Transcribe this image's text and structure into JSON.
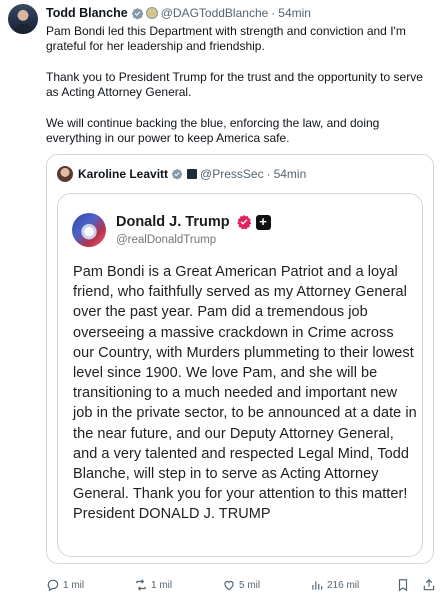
{
  "post": {
    "author_name": "Todd Blanche",
    "author_handle": "@DAGToddBlanche",
    "separator": "·",
    "time": "54min",
    "paragraphs": [
      "Pam Bondi led this Department with strength and conviction and I'm grateful for her leadership and friendship.",
      "Thank you to President Trump for the trust and the opportunity to serve as Acting Attorney General.",
      "We will continue backing the blue, enforcing the law, and doing everything in our power to keep America safe."
    ]
  },
  "quote": {
    "author_name": "Karoline Leavitt",
    "author_handle": "@PressSec",
    "separator": "·",
    "time": "54min",
    "embedded": {
      "author_name": "Donald J. Trump",
      "author_handle": "@realDonaldTrump",
      "text": "Pam Bondi is a Great American Patriot and a loyal friend, who faithfully served as my Attorney General over the past year. Pam did a tremendous job overseeing a massive crackdown in Crime across our Country, with Murders plummeting to their lowest level since 1900. We love Pam, and she will be transitioning to a much needed and important new job in the private sector, to be announced at a date in the near future, and our Deputy Attorney General, and a very talented and respected Legal Mind, Todd Blanche, will step in to serve as Acting Attorney General. Thank you for your attention to this matter! President DONALD J. TRUMP"
    }
  },
  "actions": {
    "replies": "1 mil",
    "reposts": "1 mil",
    "likes": "5 mil",
    "views": "216 mil"
  },
  "colors": {
    "verified_blue": "#1d9bf0",
    "truth_badge_pink": "#e0245e",
    "secondary_text": "#536471",
    "border": "#cfd9de"
  },
  "icons": [
    "verified-icon",
    "government-badge-icon",
    "reply-icon",
    "repost-icon",
    "like-icon",
    "views-icon",
    "bookmark-icon",
    "share-icon"
  ]
}
